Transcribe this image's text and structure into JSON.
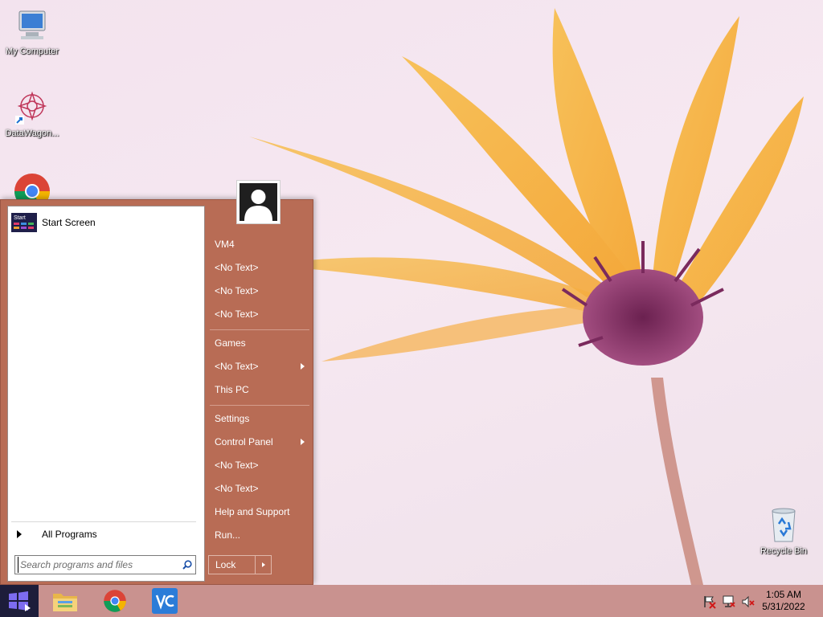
{
  "desktop": {
    "icons": [
      {
        "label": "My Computer",
        "icon": "computer-icon"
      },
      {
        "label": "DataWagon...",
        "icon": "datawagon-icon"
      },
      {
        "label": "Recycle Bin",
        "icon": "recycle-bin-icon"
      }
    ]
  },
  "start_menu": {
    "pinned": [
      {
        "label": "Start Screen",
        "thumb_text": "Start"
      }
    ],
    "all_programs_label": "All Programs",
    "search": {
      "placeholder": "Search programs and files",
      "value": ""
    },
    "right_items": [
      {
        "label": "VM4",
        "has_submenu": false
      },
      {
        "label": "<No Text>",
        "has_submenu": false
      },
      {
        "label": "<No Text>",
        "has_submenu": false
      },
      {
        "label": "<No Text>",
        "has_submenu": false
      },
      {
        "label": "Games",
        "has_submenu": false
      },
      {
        "label": "<No Text>",
        "has_submenu": true
      },
      {
        "label": "This PC",
        "has_submenu": false
      },
      {
        "label": "Settings",
        "has_submenu": false
      },
      {
        "label": "Control Panel",
        "has_submenu": true
      },
      {
        "label": "<No Text>",
        "has_submenu": false
      },
      {
        "label": "<No Text>",
        "has_submenu": false
      },
      {
        "label": "Help and Support",
        "has_submenu": false
      },
      {
        "label": "Run...",
        "has_submenu": false
      }
    ],
    "lock_label": "Lock"
  },
  "taskbar": {
    "apps": [
      "file-explorer-icon",
      "chrome-icon",
      "vnc-viewer-icon"
    ],
    "tray": [
      "action-center-flag-icon",
      "network-icon",
      "volume-muted-icon"
    ],
    "clock": {
      "time": "1:05 AM",
      "date": "5/31/2022"
    }
  },
  "colors": {
    "start_menu_bg": "#b86c55",
    "taskbar_bg": "#c9928f",
    "start_button_bg": "#1d1d3a"
  }
}
